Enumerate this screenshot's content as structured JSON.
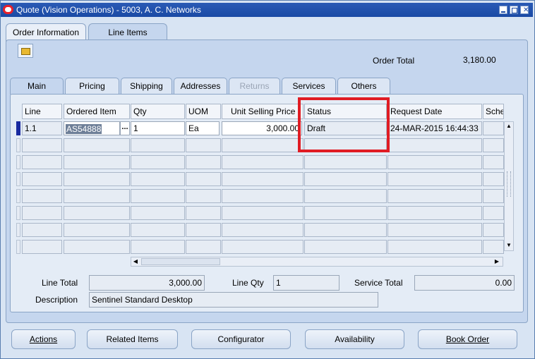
{
  "window": {
    "title": "Quote (Vision Operations) - 5003, A. C. Networks"
  },
  "outer_tabs": [
    {
      "label": "Order Information"
    },
    {
      "label": "Line Items"
    }
  ],
  "order_total": {
    "label": "Order Total",
    "value": "3,180.00"
  },
  "inner_tabs": [
    {
      "label": "Main"
    },
    {
      "label": "Pricing"
    },
    {
      "label": "Shipping"
    },
    {
      "label": "Addresses"
    },
    {
      "label": "Returns"
    },
    {
      "label": "Services"
    },
    {
      "label": "Others"
    }
  ],
  "grid": {
    "headers": [
      "Line",
      "Ordered Item",
      "Qty",
      "UOM",
      "Unit Selling Price",
      "Status",
      "Request Date",
      "Sche"
    ],
    "rows": [
      {
        "line": "1.1",
        "ordered_item": "AS54888",
        "qty": "1",
        "uom": "Ea",
        "unit_selling_price": "3,000.00",
        "status": "Draft",
        "request_date": "24-MAR-2015 16:44:33",
        "sche": ""
      }
    ],
    "lov_glyph": "...",
    "empty_rows": 7
  },
  "totals": {
    "line_total_label": "Line Total",
    "line_total_value": "3,000.00",
    "line_qty_label": "Line Qty",
    "line_qty_value": "1",
    "service_total_label": "Service Total",
    "service_total_value": "0.00",
    "description_label": "Description",
    "description_value": "Sentinel Standard Desktop"
  },
  "buttons": {
    "actions": "Actions",
    "related_items": "Related Items",
    "configurator": "Configurator",
    "availability": "Availability",
    "book_order": "Book Order"
  },
  "colors": {
    "title_bar": "#1a4aa5",
    "highlight_box": "#e01c24",
    "selected_row_marker": "#1a2ba0"
  }
}
